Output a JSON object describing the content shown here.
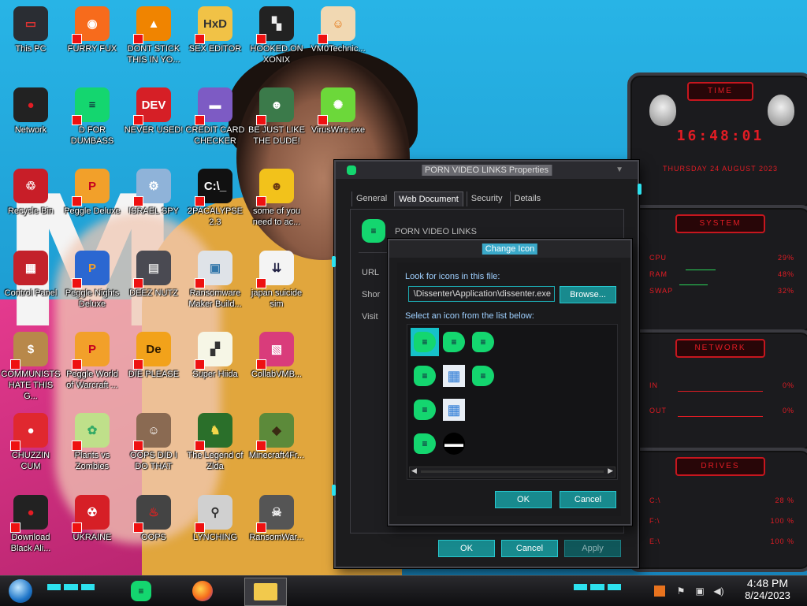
{
  "desktop_icons": [
    {
      "label": "This PC",
      "glyph": "▭",
      "bg": "#2a2d33",
      "fg": "#d33"
    },
    {
      "label": "FURRY FUX",
      "glyph": "◉",
      "bg": "#f76b1c",
      "fg": "#fff"
    },
    {
      "label": "DONT STICK THIS IN YO...",
      "glyph": "▲",
      "bg": "#f08400",
      "fg": "#fff"
    },
    {
      "label": "SEX EDITOR",
      "glyph": "HxD",
      "bg": "#f1c246",
      "fg": "#333"
    },
    {
      "label": "HOOKED ON XONIX",
      "glyph": "▚",
      "bg": "#222",
      "fg": "#eee"
    },
    {
      "label": "VM0Technic...",
      "glyph": "☺",
      "bg": "#f1d8b2",
      "fg": "#e36a00"
    },
    {
      "label": "Network",
      "glyph": "●",
      "bg": "#222",
      "fg": "#e31c24"
    },
    {
      "label": "D FOR DUMBASS",
      "glyph": "≡",
      "bg": "#14d66f",
      "fg": "#113"
    },
    {
      "label": "NEVER USED!",
      "glyph": "DEV",
      "bg": "#d61f26",
      "fg": "#fff"
    },
    {
      "label": "CREDIT CARD CHECKER",
      "glyph": "▬",
      "bg": "#7d5bc4",
      "fg": "#fff"
    },
    {
      "label": "BE JUST LIKE THE DUDE!",
      "glyph": "☻",
      "bg": "#3b7a4a",
      "fg": "#fff"
    },
    {
      "label": "VirusWire.exe",
      "glyph": "✺",
      "bg": "#6cd83a",
      "fg": "#fff"
    },
    {
      "label": "Recycle Bin",
      "glyph": "♲",
      "bg": "#c81e28",
      "fg": "#fff"
    },
    {
      "label": "Peggle Deluxe",
      "glyph": "P",
      "bg": "#f2a02a",
      "fg": "#c6001e"
    },
    {
      "label": "ISRAEL SPY",
      "glyph": "⚙",
      "bg": "#8fb3d9",
      "fg": "#fff"
    },
    {
      "label": "2PACALYPSE 2.3",
      "glyph": "C:\\_",
      "bg": "#111",
      "fg": "#fff"
    },
    {
      "label": "some of you need to ac...",
      "glyph": "☻",
      "bg": "#f2c21b",
      "fg": "#6a3a12"
    },
    {
      "label": "Control Panel",
      "glyph": "▦",
      "bg": "#c3222b",
      "fg": "#fff"
    },
    {
      "label": "Peggle Nights Deluxe",
      "glyph": "P",
      "bg": "#2b67d1",
      "fg": "#f2a02a"
    },
    {
      "label": "DEEZ NUTZ",
      "glyph": "▤",
      "bg": "#4a4a52",
      "fg": "#ddd"
    },
    {
      "label": "Ransomware Maker Build...",
      "glyph": "▣",
      "bg": "#dfe3e8",
      "fg": "#37a"
    },
    {
      "label": "japan suicide sim",
      "glyph": "⇊",
      "bg": "#f4f4f4",
      "fg": "#224"
    },
    {
      "label": "COMMUNISTS HATE THIS G...",
      "glyph": "$",
      "bg": "#b8884a",
      "fg": "#fff"
    },
    {
      "label": "Peggle World of Warcraft ...",
      "glyph": "P",
      "bg": "#f2a02a",
      "fg": "#c6001e"
    },
    {
      "label": "DIE PLEASE",
      "glyph": "De",
      "bg": "#f2a21a",
      "fg": "#2d1a00"
    },
    {
      "label": "Super Hiida",
      "glyph": "▞",
      "bg": "#f6f6e6",
      "fg": "#333"
    },
    {
      "label": "CollabVMB...",
      "glyph": "▧",
      "bg": "#d93c7b",
      "fg": "#fff"
    },
    {
      "label": "CHUZZIN CUM",
      "glyph": "●",
      "bg": "#e0282f",
      "fg": "#fff"
    },
    {
      "label": "Plants vs Zombies",
      "glyph": "✿",
      "bg": "#bfe08a",
      "fg": "#3a6"
    },
    {
      "label": "OOPS DID I DO THAT",
      "glyph": "☺",
      "bg": "#8a6a52",
      "fg": "#fff"
    },
    {
      "label": "The Legend of Zlda",
      "glyph": "♞",
      "bg": "#2a6f2a",
      "fg": "#f2d64a"
    },
    {
      "label": "Minecraft4Fr...",
      "glyph": "◆",
      "bg": "#5c8a3a",
      "fg": "#3a2a12"
    },
    {
      "label": "Download Black Ali...",
      "glyph": "●",
      "bg": "#222",
      "fg": "#e31c24"
    },
    {
      "label": "UKRAINE",
      "glyph": "☢",
      "bg": "#d61f26",
      "fg": "#fff"
    },
    {
      "label": "OOPS",
      "glyph": "♨",
      "bg": "#444",
      "fg": "#d22"
    },
    {
      "label": "LYNCHING",
      "glyph": "⚲",
      "bg": "#d0d0d0",
      "fg": "#333"
    },
    {
      "label": "RansomWar...",
      "glyph": "☠",
      "bg": "#555",
      "fg": "#eee"
    }
  ],
  "gadgets": {
    "time": {
      "title": "TIME",
      "clock": "16:48:01",
      "date": "THURSDAY 24 AUGUST 2023"
    },
    "system": {
      "title": "SYSTEM",
      "rows": [
        {
          "label": "CPU",
          "value": "29%"
        },
        {
          "label": "RAM",
          "value": "48%"
        },
        {
          "label": "SWAP",
          "value": "32%"
        }
      ]
    },
    "network": {
      "title": "NETWORK",
      "rows": [
        {
          "label": "IN",
          "value": "0%"
        },
        {
          "label": "OUT",
          "value": "0%"
        }
      ]
    },
    "drives": {
      "title": "DRIVES",
      "rows": [
        {
          "label": "C:\\",
          "value": "28 %"
        },
        {
          "label": "F:\\",
          "value": "100 %"
        },
        {
          "label": "E:\\",
          "value": "100 %"
        }
      ]
    }
  },
  "properties_window": {
    "title": "PORN VIDEO LINKS Properties",
    "tabs": [
      "General",
      "Web Document",
      "Security",
      "Details"
    ],
    "active_tab": "Web Document",
    "item_name": "PORN VIDEO LINKS",
    "side_labels": [
      "URL",
      "Shor",
      "Visit"
    ],
    "buttons": {
      "ok": "OK",
      "cancel": "Cancel",
      "apply": "Apply"
    }
  },
  "change_icon_dialog": {
    "title": "Change Icon",
    "look_label": "Look for icons in this file:",
    "file_path": "\\Dissenter\\Application\\dissenter.exe",
    "browse": "Browse...",
    "select_label": "Select an icon from the list below:",
    "buttons": {
      "ok": "OK",
      "cancel": "Cancel"
    }
  },
  "taskbar": {
    "time": "4:48 PM",
    "date": "8/24/2023"
  },
  "colors": {
    "accent_teal": "#188a8e",
    "alien_red": "#e31c24",
    "dissenter_green": "#14d66f"
  }
}
